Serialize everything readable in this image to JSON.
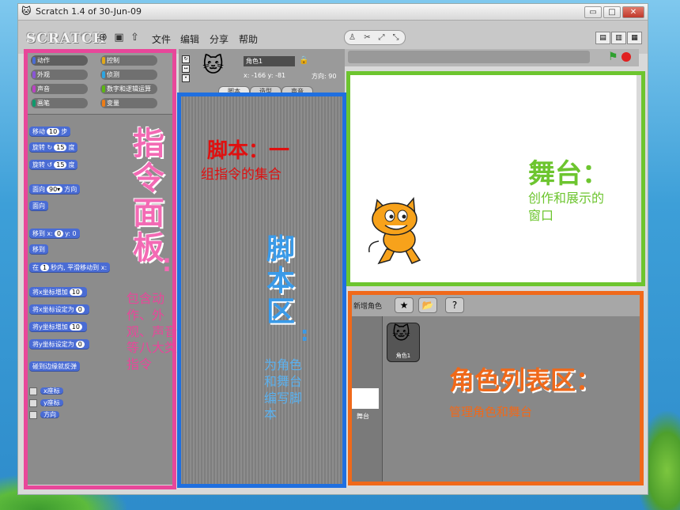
{
  "window": {
    "title": "Scratch 1.4 of 30-Jun-09",
    "controls": {
      "minimize": "▭",
      "maximize": "□",
      "close": "✕"
    }
  },
  "menubar": {
    "logo": "SCRATCH",
    "icons": [
      "globe-icon",
      "save-icon",
      "share-icon"
    ],
    "items": [
      "文件",
      "编辑",
      "分享",
      "帮助"
    ]
  },
  "categories": [
    {
      "label": "动作",
      "color": "#4a6cd4"
    },
    {
      "label": "控制",
      "color": "#e1a91a"
    },
    {
      "label": "外观",
      "color": "#8a55d7"
    },
    {
      "label": "侦测",
      "color": "#2ca5e2"
    },
    {
      "label": "声音",
      "color": "#bb42c3"
    },
    {
      "label": "数字和逻辑运算",
      "color": "#5cb712"
    },
    {
      "label": "画笔",
      "color": "#0e9a6c"
    },
    {
      "label": "变量",
      "color": "#ee7d16"
    }
  ],
  "blocks": [
    {
      "pre": "移动",
      "num": "10",
      "post": "步"
    },
    {
      "pre": "旋转 ↻",
      "num": "15",
      "post": "度"
    },
    {
      "pre": "旋转 ↺",
      "num": "15",
      "post": "度"
    },
    {
      "pre": "面向",
      "num": "90▾",
      "post": "方向"
    },
    {
      "pre": "面向",
      "num": "",
      "post": ""
    },
    {
      "pre": "移到 x:",
      "num": "0",
      "post": "y: 0"
    },
    {
      "pre": "移到",
      "num": "",
      "post": ""
    },
    {
      "pre": "在",
      "num": "1",
      "post": "秒内, 平滑移动到 x:"
    },
    {
      "pre": "将x坐标增加",
      "num": "10",
      "post": ""
    },
    {
      "pre": "将x坐标设定为",
      "num": "0",
      "post": ""
    },
    {
      "pre": "将y坐标增加",
      "num": "10",
      "post": ""
    },
    {
      "pre": "将y坐标设定为",
      "num": "0",
      "post": ""
    },
    {
      "pre": "碰到边缘就反弹",
      "num": "",
      "post": ""
    }
  ],
  "reporters": [
    "x座标",
    "y座标",
    "方向"
  ],
  "sprite": {
    "name": "角色1",
    "coords": "x: -166  y: -81",
    "direction": "方向: 90",
    "tabs": [
      "脚本",
      "造型",
      "声音"
    ]
  },
  "spritelist": {
    "new_sprite_label": "新增角色",
    "sprite_label": "角色1",
    "stage_label": "舞台"
  },
  "annotations": {
    "palette_title": "指令面板",
    "palette_desc": "包含动作、外观、声音等八大类指令",
    "scripts_red_title": "脚本：一",
    "scripts_red_desc": "组指令的集合",
    "scripts_area_title": "脚本区",
    "scripts_area_desc": "为角色和舞台编写脚本",
    "stage_title": "舞台：",
    "stage_desc": "创作和展示的窗口",
    "sprites_title": "角色列表区：",
    "sprites_desc": "管理角色和舞台"
  },
  "colors": {
    "palette_frame": "#e8479a",
    "scripts_frame": "#1f6fe0",
    "stage_frame": "#6dc52f",
    "sprites_frame": "#f0691a"
  }
}
